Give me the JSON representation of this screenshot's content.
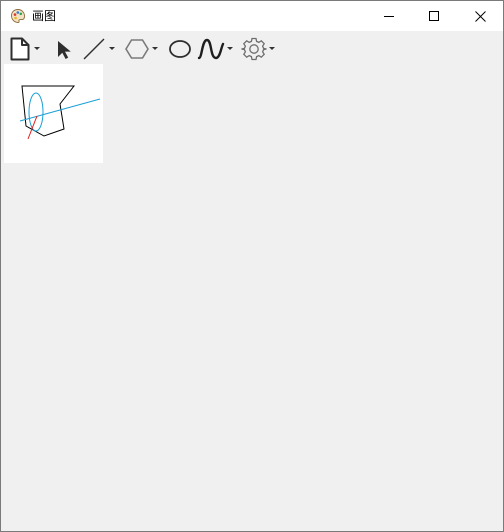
{
  "window": {
    "title": "画图"
  },
  "title_buttons": [
    {
      "name": "minimize",
      "icon": "minimize-icon"
    },
    {
      "name": "maximize",
      "icon": "maximize-icon"
    },
    {
      "name": "close",
      "icon": "close-icon"
    }
  ],
  "toolbar": {
    "tools": [
      {
        "name": "new-document",
        "icon": "new-document-icon",
        "has_dropdown": true
      },
      {
        "name": "select",
        "icon": "cursor-arrow-icon",
        "has_dropdown": false
      },
      {
        "name": "line",
        "icon": "line-icon",
        "has_dropdown": true
      },
      {
        "name": "polygon",
        "icon": "hexagon-icon",
        "has_dropdown": true
      },
      {
        "name": "ellipse",
        "icon": "ellipse-icon",
        "has_dropdown": false
      },
      {
        "name": "curve",
        "icon": "curve-icon",
        "has_dropdown": true
      },
      {
        "name": "settings",
        "icon": "gear-icon",
        "has_dropdown": true
      }
    ]
  },
  "canvas": {
    "shapes": [
      {
        "type": "polygon",
        "color": "#000000"
      },
      {
        "type": "ellipse",
        "color": "#1a9fd6"
      },
      {
        "type": "line",
        "color": "#1a9fd6"
      },
      {
        "type": "line",
        "color": "#e02020"
      }
    ]
  },
  "colors": {
    "background": "#f0f0f0",
    "titlebar": "#ffffff",
    "canvas": "#ffffff",
    "accent": "#1a9fd6"
  }
}
